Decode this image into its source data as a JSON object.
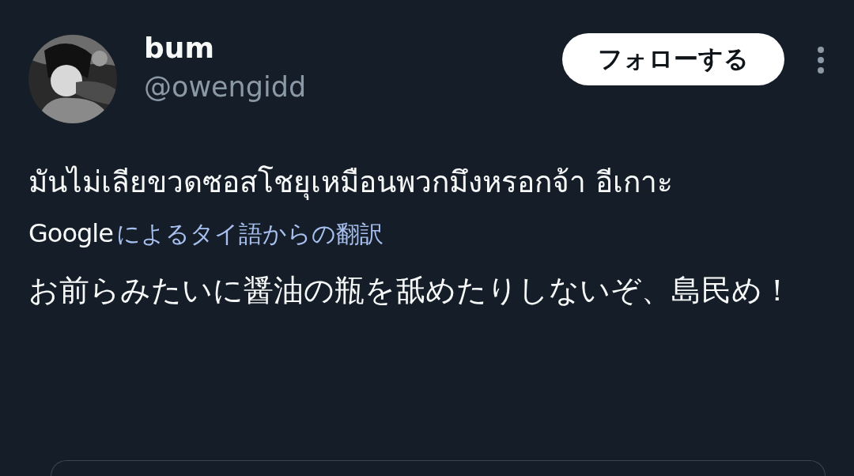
{
  "author": {
    "name": "bum",
    "handle": "@owengidd"
  },
  "follow_button": {
    "label": "フォローする"
  },
  "tweet_text": "มันไม่เลียขวดซอสโชยุเหมือนพวกมึงหรอกจ้า อีเกาะ",
  "translation": {
    "provider": "Google",
    "label": "によるタイ語からの翻訳",
    "text": "お前らみたいに醤油の瓶を舐めたりしないぞ、島民め！"
  }
}
